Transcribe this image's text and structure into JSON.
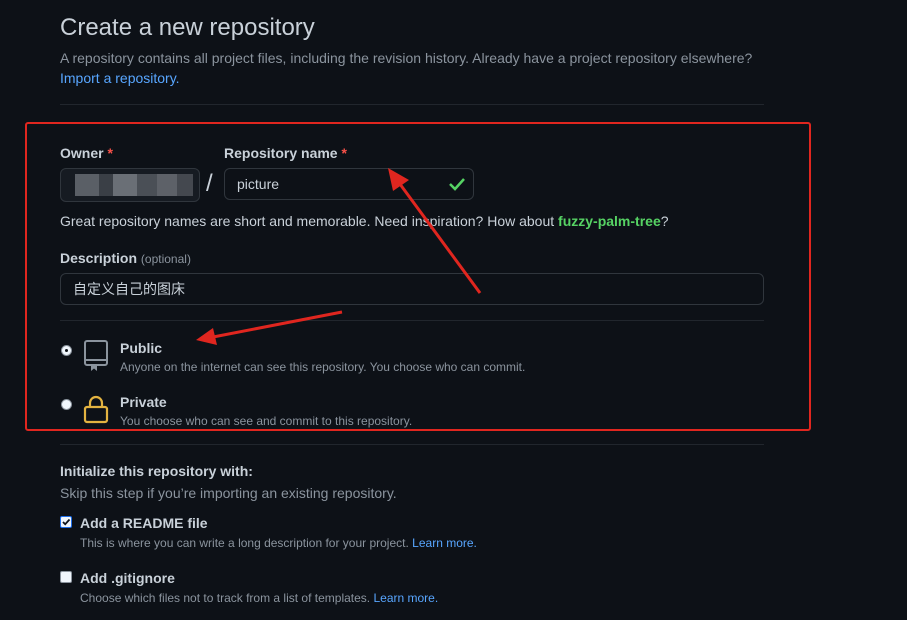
{
  "header": {
    "title": "Create a new repository",
    "subtitle": "A repository contains all project files, including the revision history. Already have a project repository elsewhere?",
    "import_link": "Import a repository."
  },
  "owner": {
    "label": "Owner",
    "required_mark": "*"
  },
  "repo_name": {
    "label": "Repository name",
    "required_mark": "*",
    "value": "picture",
    "separator": "/"
  },
  "hint": {
    "text": "Great repository names are short and memorable. Need inspiration? How about ",
    "suggestion": "fuzzy-palm-tree",
    "end": "?"
  },
  "description": {
    "label": "Description",
    "optional": "(optional)",
    "value": "自定义自己的图床"
  },
  "visibility": {
    "public": {
      "title": "Public",
      "desc": "Anyone on the internet can see this repository. You choose who can commit.",
      "selected": true,
      "icon": "repo-icon"
    },
    "private": {
      "title": "Private",
      "desc": "You choose who can see and commit to this repository.",
      "selected": false,
      "icon": "lock-icon"
    }
  },
  "init": {
    "title": "Initialize this repository with:",
    "subtitle": "Skip this step if you’re importing an existing repository.",
    "readme": {
      "label": "Add a README file",
      "desc": "This is where you can write a long description for your project.",
      "link": "Learn more.",
      "checked": true
    },
    "gitignore": {
      "label": "Add .gitignore",
      "desc": "Choose which files not to track from a list of templates.",
      "link": "Learn more.",
      "checked": false
    }
  },
  "colors": {
    "background": "#0d1117",
    "accent_link": "#58a6ff",
    "success": "#56d364",
    "annotation_red": "#e0261f",
    "lock_yellow": "#e3b341"
  }
}
